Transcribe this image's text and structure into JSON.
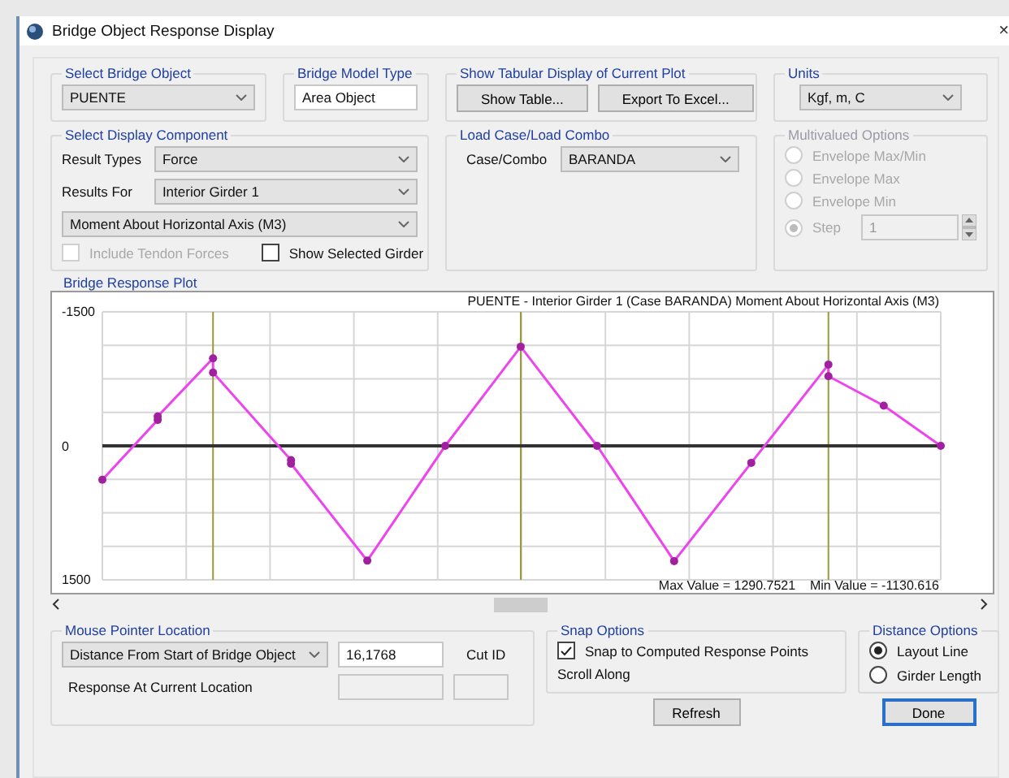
{
  "window": {
    "title": "Bridge Object Response Display",
    "close": "×"
  },
  "select_bridge_object": {
    "label": "Select Bridge Object",
    "value": "PUENTE"
  },
  "bridge_model_type": {
    "label": "Bridge Model Type",
    "value": "Area Object"
  },
  "tabular_display": {
    "label": "Show Tabular Display of Current Plot",
    "buttons": [
      "Show Table...",
      "Export To Excel..."
    ]
  },
  "units": {
    "label": "Units",
    "value": "Kgf, m, C"
  },
  "display_component": {
    "label": "Select Display Component",
    "rows": [
      {
        "label": "Result Types",
        "value": "Force"
      },
      {
        "label": "Results For",
        "value": "Interior Girder 1"
      }
    ],
    "component": "Moment About Horizontal Axis  (M3)",
    "checkboxes": [
      {
        "label": "Include Tendon Forces",
        "checked": false,
        "disabled": true
      },
      {
        "label": "Show Selected Girder",
        "checked": false,
        "disabled": false
      }
    ]
  },
  "load_case": {
    "label": "Load Case/Load Combo",
    "field_label": "Case/Combo",
    "value": "BARANDA"
  },
  "multivalued": {
    "label": "Multivalued Options",
    "disabled": true,
    "options": [
      {
        "label": "Envelope Max/Min",
        "selected": false
      },
      {
        "label": "Envelope Max",
        "selected": false
      },
      {
        "label": "Envelope Min",
        "selected": false
      },
      {
        "label": "Step",
        "selected": true
      }
    ],
    "step_value": "1"
  },
  "plot": {
    "label": "Bridge Response Plot",
    "title": "PUENTE - Interior Girder 1   (Case BARANDA)   Moment About Horizontal Axis  (M3)",
    "max": "Max Value = 1290.7521",
    "min": "Min Value = -1130.616",
    "axis_labels": [
      "-1500",
      "0",
      "1500"
    ]
  },
  "mouse_pointer": {
    "label": "Mouse Pointer Location",
    "measure": "Distance From Start of Bridge Object",
    "distance": "16,1768",
    "cut_id_label": "Cut ID",
    "response_label": "Response At Current Location"
  },
  "snap": {
    "label": "Snap Options",
    "checkbox": {
      "label": "Snap to Computed Response Points",
      "checked": true
    },
    "scroll_along": "Scroll Along"
  },
  "distance_options": {
    "label": "Distance Options",
    "options": [
      {
        "label": "Layout Line",
        "selected": true
      },
      {
        "label": "Girder Length",
        "selected": false
      }
    ]
  },
  "buttons": [
    {
      "label": "Refresh",
      "default": false
    },
    {
      "label": "Done",
      "default": true
    }
  ]
}
